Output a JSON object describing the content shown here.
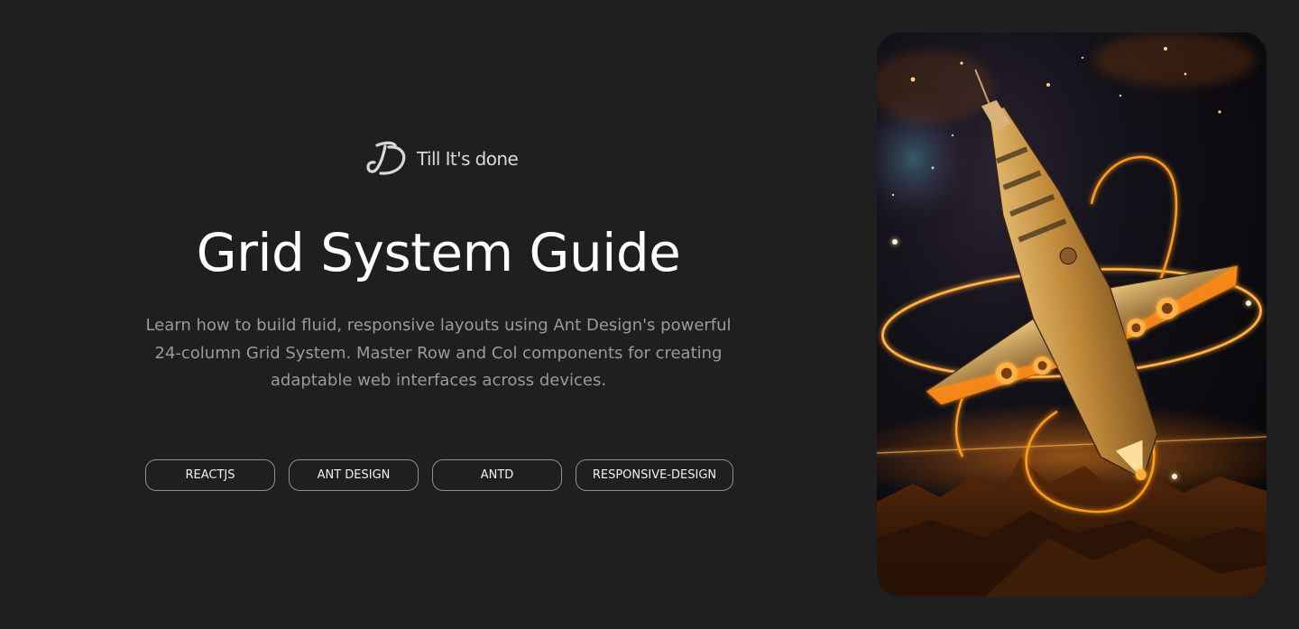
{
  "brand": {
    "name": "Till It's done",
    "logo_icon": "td-monogram-logo"
  },
  "hero": {
    "title": "Grid System Guide",
    "description": "Learn how to build fluid, responsive layouts using Ant Design's powerful 24-column Grid System. Master Row and Col components for creating adaptable web interfaces across devices."
  },
  "tags": [
    {
      "label": "REACTJS"
    },
    {
      "label": "ANT DESIGN"
    },
    {
      "label": "ANTD"
    },
    {
      "label": "RESPONSIVE-DESIGN"
    }
  ],
  "image": {
    "subject": "golden spaceship with orbiting energy rings over a desert planet"
  },
  "colors": {
    "background": "#1f1f1f",
    "title": "#ffffff",
    "description": "#9a9a9a",
    "tag_border": "#8e8e8e",
    "accent_glow": "#ff9a1a"
  }
}
